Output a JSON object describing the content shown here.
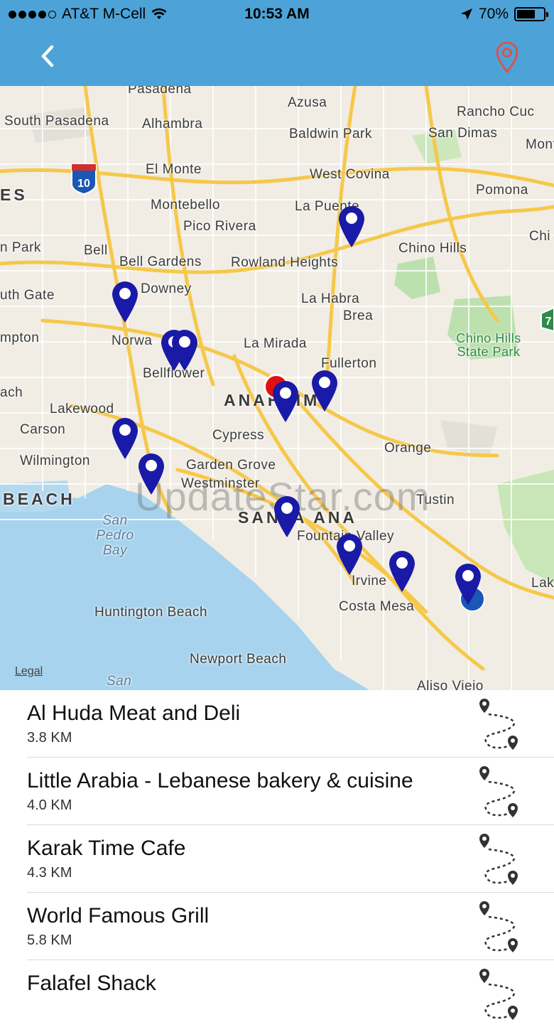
{
  "status_bar": {
    "carrier": "AT&T M-Cell",
    "time": "10:53 AM",
    "battery": "70%",
    "battery_level": 0.7
  },
  "nav": {
    "back_icon": "chevron-left-icon",
    "right_icon": "map-pin-outline-icon"
  },
  "map": {
    "legal": "Legal",
    "watermark": "UpdateStar.com",
    "cities": [
      "Pasadena",
      "Azusa",
      "Rancho Cuc",
      "South Pasadena",
      "Alhambra",
      "Baldwin Park",
      "San Dimas",
      "Mont",
      "El Monte",
      "West Covina",
      "Pomona",
      "ES",
      "Montebello",
      "La Puente",
      "Pico Rivera",
      "Chi",
      "n Park",
      "Bell",
      "Bell Gardens",
      "Rowland Heights",
      "Chino Hills",
      "uth Gate",
      "Downey",
      "La Habra",
      "Brea",
      "mpton",
      "Norwa",
      "La Mirada",
      "Chino Hills State Park",
      "Bellflower",
      "Fullerton",
      "ach",
      "ANAHEIM",
      "Lakewood",
      "Carson",
      "Cypress",
      "Orange",
      "Wilmington",
      "Garden Grove",
      "Westminster",
      "BEACH",
      "Tustin",
      "SANTA ANA",
      "San Pedro Bay",
      "Fountain Valley",
      "Irvine",
      "Lak",
      "Costa Mesa",
      "Huntington Beach",
      "Newport Beach",
      "San",
      "Aliso Viejo"
    ],
    "highway_labels": [
      "10",
      "7"
    ]
  },
  "places": [
    {
      "name": "Al Huda Meat and Deli",
      "distance": "3.8 KM"
    },
    {
      "name": "Little Arabia - Lebanese bakery & cuisine",
      "distance": "4.0 KM"
    },
    {
      "name": "Karak Time Cafe",
      "distance": "4.3 KM"
    },
    {
      "name": "World Famous Grill",
      "distance": "5.8 KM"
    },
    {
      "name": "Falafel Shack",
      "distance": ""
    }
  ],
  "colors": {
    "nav_bar": "#4da3d7",
    "marker": "#1a1aa8",
    "current_location": "#e01010",
    "nav_pin": "#d9534f"
  }
}
